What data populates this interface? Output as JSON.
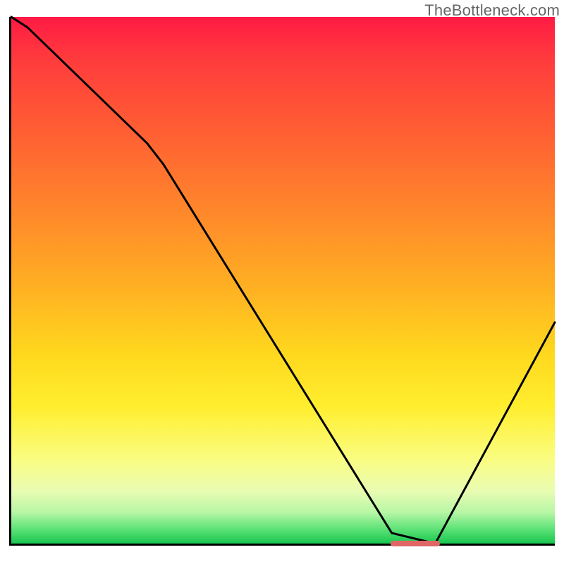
{
  "watermark": "TheBottleneck.com",
  "chart_data": {
    "type": "line",
    "title": "",
    "xlabel": "",
    "ylabel": "",
    "xlim": [
      0,
      100
    ],
    "ylim": [
      0,
      100
    ],
    "grid": false,
    "legend": false,
    "series": [
      {
        "name": "curve",
        "x": [
          0,
          3,
          25,
          28,
          70,
          78,
          100
        ],
        "y": [
          100,
          98,
          76,
          72,
          2,
          0,
          42
        ]
      }
    ],
    "marker": {
      "x_start": 70,
      "x_end": 78,
      "y": 0
    }
  },
  "colors": {
    "axis": "#000000",
    "watermark": "#666666",
    "marker": "#e06666"
  }
}
